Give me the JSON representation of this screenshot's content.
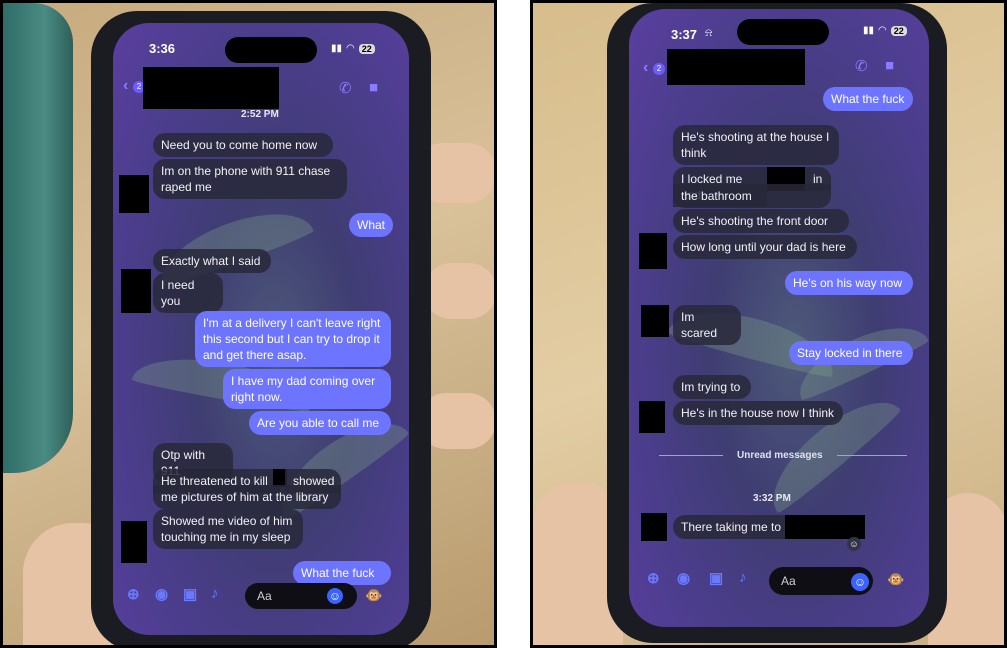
{
  "left": {
    "status_time": "3:36",
    "battery": "22",
    "back_count": "2",
    "timestamp": "2:52 PM",
    "messages": [
      {
        "dir": "in",
        "text": "Need you to come home now"
      },
      {
        "dir": "in",
        "text": "Im on the phone with 911 chase raped me"
      },
      {
        "dir": "out",
        "text": "What"
      },
      {
        "dir": "in",
        "text": "Exactly what I said"
      },
      {
        "dir": "in",
        "text": "I need you"
      },
      {
        "dir": "out",
        "text": "I'm at a delivery I can't leave right this second but I can try to drop it and get there asap."
      },
      {
        "dir": "out",
        "text": "I have my dad coming over right now."
      },
      {
        "dir": "out",
        "text": "Are you able to call me"
      },
      {
        "dir": "in",
        "text": "Otp with 911"
      },
      {
        "dir": "in",
        "text": "He threatened to kill"
      },
      {
        "dir": "in",
        "text": "showed"
      },
      {
        "dir": "in",
        "text": "me pictures of him at the library"
      },
      {
        "dir": "in",
        "text": "Showed me video of him touching me in my sleep"
      },
      {
        "dir": "out",
        "text": "What the fuck"
      }
    ],
    "composer_placeholder": "Aa"
  },
  "right": {
    "status_time": "3:37",
    "battery": "22",
    "back_count": "2",
    "messages": [
      {
        "dir": "out",
        "text": "What the fuck"
      },
      {
        "dir": "in",
        "text": "He's shooting at the house I think"
      },
      {
        "dir": "in",
        "text": "I locked me and"
      },
      {
        "dir": "in",
        "text": "in"
      },
      {
        "dir": "in",
        "text": "the bathroom"
      },
      {
        "dir": "in",
        "text": "He's shooting the front door"
      },
      {
        "dir": "in",
        "text": "How long until your dad is here"
      },
      {
        "dir": "out",
        "text": "He's on his way now"
      },
      {
        "dir": "in",
        "text": "Im scared"
      },
      {
        "dir": "out",
        "text": "Stay locked in there"
      },
      {
        "dir": "in",
        "text": "Im trying to"
      },
      {
        "dir": "in",
        "text": "He's in the house now I think"
      },
      {
        "dir": "in",
        "text": "There taking me to"
      }
    ],
    "unread_label": "Unread messages",
    "timestamp": "3:32 PM",
    "composer_placeholder": "Aa"
  },
  "colors": {
    "outgoing_bubble": "#6d74ff",
    "incoming_bubble": "#28283a",
    "accent": "#8a7cff"
  },
  "icons": [
    "back-arrow-icon",
    "phone-call-icon",
    "video-call-icon",
    "plus-icon",
    "camera-icon",
    "image-icon",
    "microphone-icon",
    "emoji-icon",
    "monkey-sticker-icon",
    "signal-icon",
    "wifi-icon",
    "battery-icon",
    "bell-muted-icon"
  ]
}
